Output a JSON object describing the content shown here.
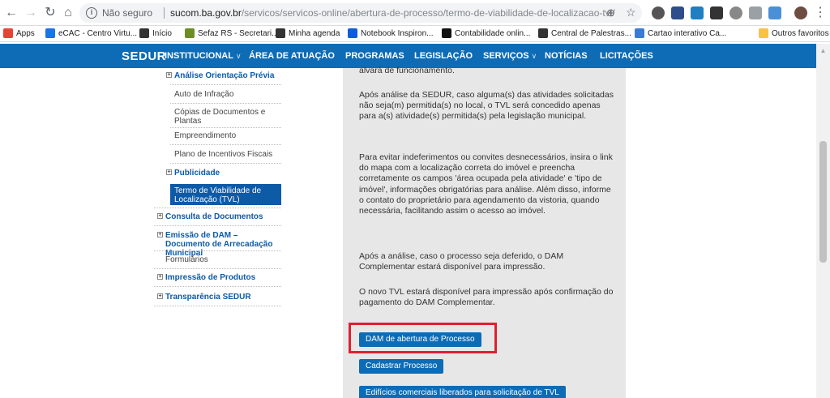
{
  "browser": {
    "not_secure": "Não seguro",
    "url_host": "sucom.ba.gov.br",
    "url_path": "/servicos/servicos-online/abertura-de-processo/termo-de-viabilidade-de-localizacao-tvl/"
  },
  "bookmarks": [
    {
      "label": "Apps",
      "color": "#e94235"
    },
    {
      "label": "eCAC - Centro Virtu...",
      "color": "#1a73e8"
    },
    {
      "label": "Início",
      "color": "#333333"
    },
    {
      "label": "Sefaz RS - Secretari...",
      "color": "#6b8e23"
    },
    {
      "label": "Minha agenda",
      "color": "#333333"
    },
    {
      "label": "Notebook Inspiron...",
      "color": "#0b5ed7"
    },
    {
      "label": "Contabilidade onlin...",
      "color": "#111111"
    },
    {
      "label": "Central de Palestras...",
      "color": "#333333"
    },
    {
      "label": "Cartao interativo Ca...",
      "color": "#3a7bd5"
    },
    {
      "label": "Outros favoritos",
      "color": "#f6c343"
    }
  ],
  "site": {
    "logo": "SEDUR",
    "menu": [
      "INSTITUCIONAL",
      "ÁREA DE ATUAÇÃO",
      "PROGRAMAS",
      "LEGISLAÇÃO",
      "SERVIÇOS",
      "NOTÍCIAS",
      "LICITAÇÕES"
    ]
  },
  "sidebar": {
    "items": [
      {
        "label": "Análise Orientação Prévia",
        "bold": true
      },
      {
        "label": "Auto de Infração"
      },
      {
        "label": "Cópias de Documentos e Plantas"
      },
      {
        "label": "Empreendimento"
      },
      {
        "label": "Plano de Incentivos Fiscais"
      },
      {
        "label": "Publicidade",
        "bold": true
      },
      {
        "label": "Termo de Viabilidade de Localização (TVL)",
        "active": true
      },
      {
        "label": "Consulta de Documentos",
        "bold": true
      },
      {
        "label": "Emissão de DAM – Documento de Arrecadação Municipal",
        "bold": true
      },
      {
        "label": "Formulários"
      },
      {
        "label": "Impressão de Produtos",
        "bold": true
      },
      {
        "label": "Transparência SEDUR",
        "bold": true
      }
    ]
  },
  "content": {
    "p0": "alvará de funcionamento.",
    "p1": "Após análise da SEDUR, caso alguma(s) das atividades solicitadas não seja(m) permitida(s) no local, o TVL será concedido apenas para a(s) atividade(s) permitida(s) pela legislação municipal.",
    "p2": "Para evitar indeferimentos ou convites desnecessários, insira o link do mapa com a localização correta do imóvel e preencha corretamente os campos 'área ocupada pela atividade' e 'tipo de imóvel', informações obrigatórias para análise. Além disso, informe o contato do proprietário para agendamento da vistoria, quando necessária, facilitando assim o acesso ao imóvel.",
    "p3": "Após a análise, caso o processo seja deferido, o DAM Complementar estará disponível para impressão.",
    "p4": "O novo TVL estará disponível para impressão após confirmação do pagamento do DAM Complementar.",
    "btn_dam": "DAM de abertura de Processo",
    "btn_cadastrar": "Cadastrar Processo",
    "btn_edificios": "Edifícios comerciais liberados para solicitação de TVL"
  }
}
